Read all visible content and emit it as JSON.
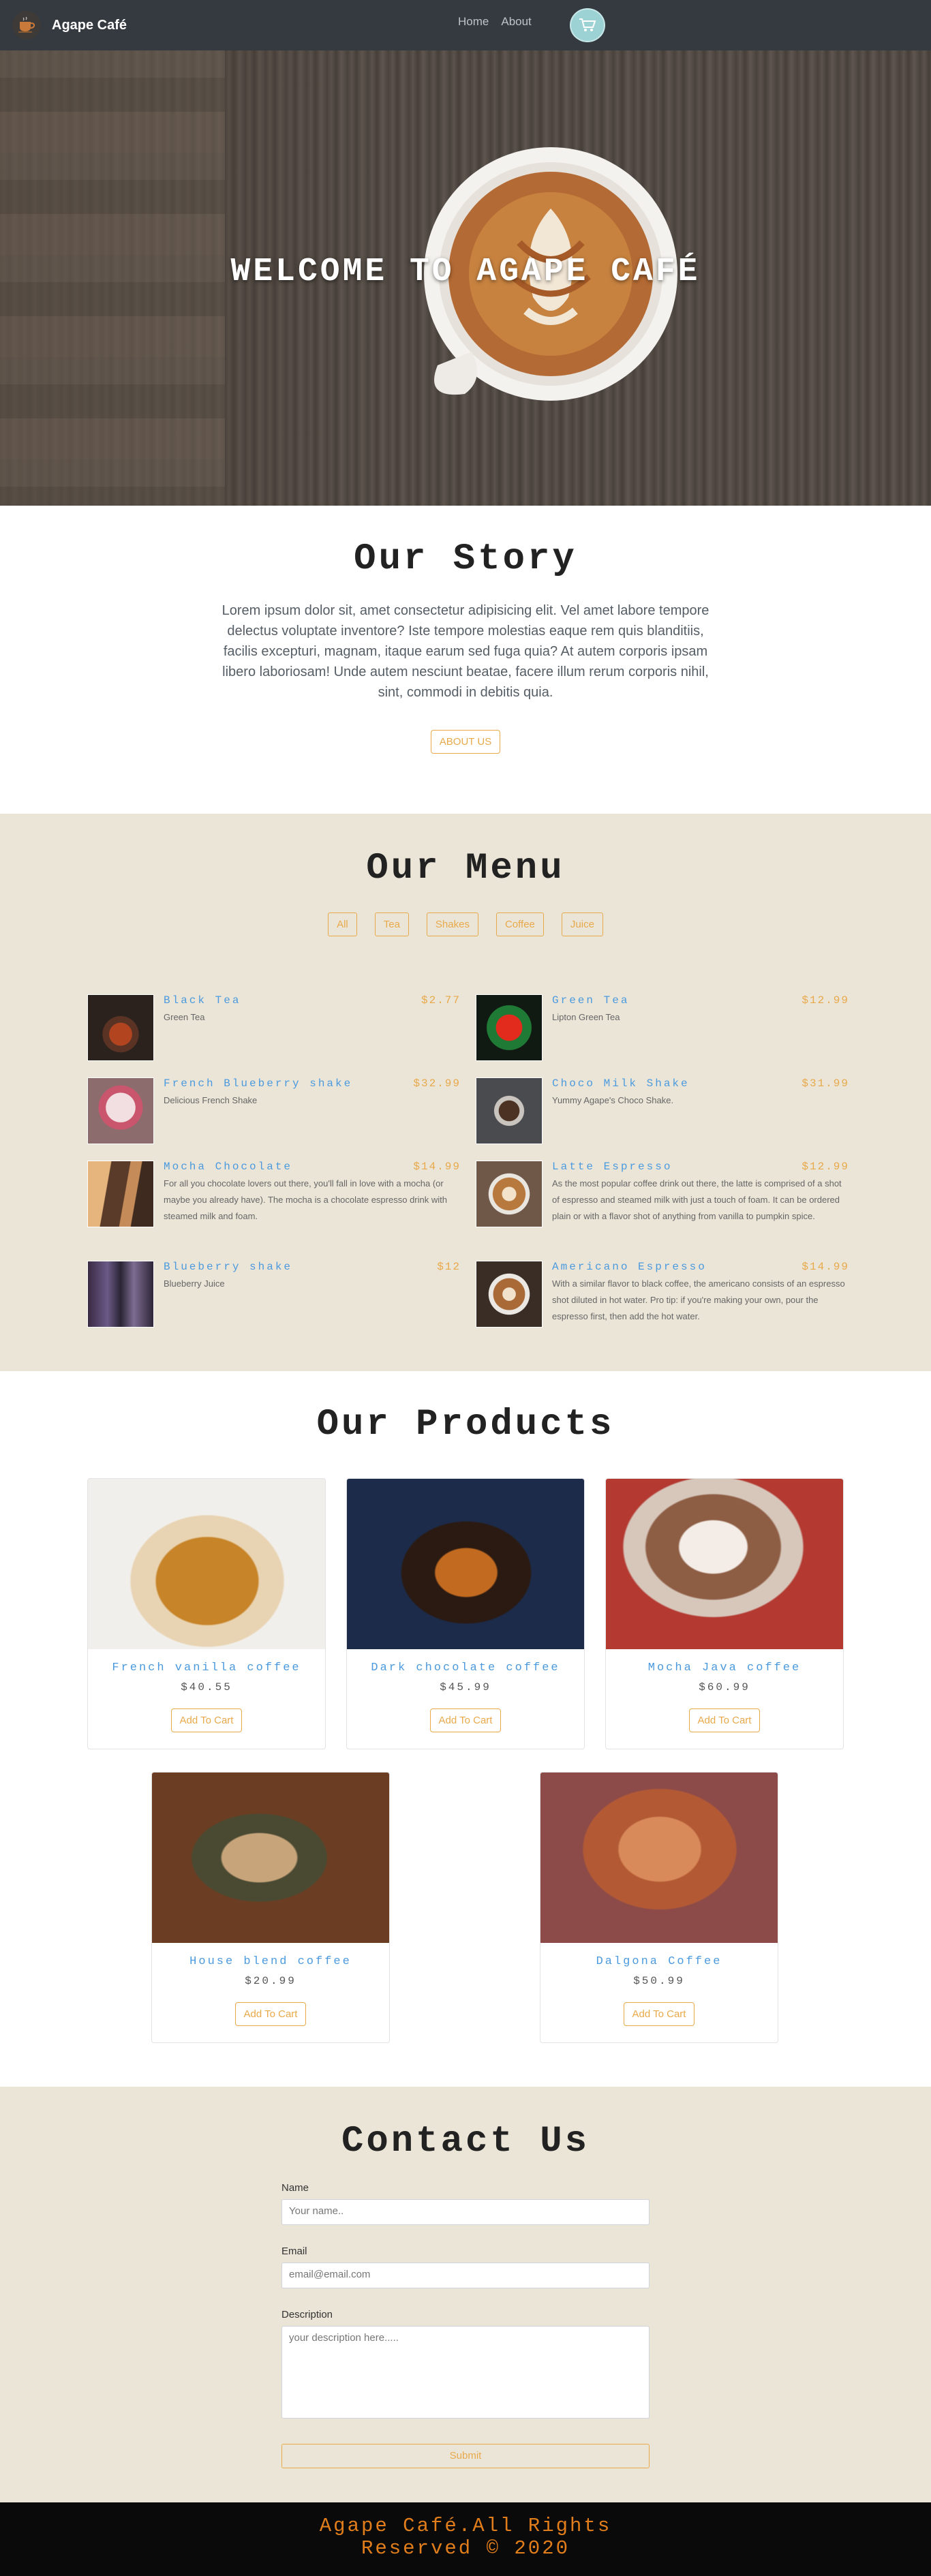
{
  "navbar": {
    "brand": "Agape Café",
    "links": [
      "Home",
      "About"
    ],
    "logo_icon": "coffee-cup-icon",
    "cart_icon": "shopping-cart-icon"
  },
  "hero": {
    "title": "WELCOME TO AGAPE CAFÉ"
  },
  "story": {
    "title": "Our Story",
    "text": "Lorem ipsum dolor sit, amet consectetur adipisicing elit. Vel amet labore tempore delectus voluptate inventore? Iste tempore molestias eaque rem quis blanditiis, facilis excepturi, magnam, itaque earum sed fuga quia? At autem corporis ipsam libero laboriosam! Unde autem nesciunt beatae, facere illum rerum corporis nihil, sint, commodi in debitis quia.",
    "button": "ABOUT US"
  },
  "menu": {
    "title": "Our Menu",
    "filters": [
      "All",
      "Tea",
      "Shakes",
      "Coffee",
      "Juice"
    ],
    "items": [
      {
        "name": "Black Tea",
        "price": "$2.77",
        "desc": "Green Tea"
      },
      {
        "name": "Green Tea",
        "price": "$12.99",
        "desc": "Lipton Green Tea"
      },
      {
        "name": "French Blueberry shake",
        "price": "$32.99",
        "desc": "Delicious French Shake"
      },
      {
        "name": "Choco Milk Shake",
        "price": "$31.99",
        "desc": "Yummy Agape's Choco Shake."
      },
      {
        "name": "Mocha Chocolate",
        "price": "$14.99",
        "desc": "For all you chocolate lovers out there, you'll fall in love with a mocha (or maybe you already have). The mocha is a chocolate espresso drink with steamed milk and foam."
      },
      {
        "name": "Latte Espresso",
        "price": "$12.99",
        "desc": "As the most popular coffee drink out there, the latte is comprised of a shot of espresso and steamed milk with just a touch of foam. It can be ordered plain or with a flavor shot of anything from vanilla to pumpkin spice."
      },
      {
        "name": "Blueberry shake",
        "price": "$12",
        "desc": "Blueberry Juice"
      },
      {
        "name": "Americano Espresso",
        "price": "$14.99",
        "desc": "With a similar flavor to black coffee, the americano consists of an espresso shot diluted in hot water. Pro tip: if you're making your own, pour the espresso first, then add the hot water."
      }
    ]
  },
  "products": {
    "title": "Our Products",
    "button": "Add To Cart",
    "items": [
      {
        "name": "French vanilla coffee",
        "price": "$40.55"
      },
      {
        "name": "Dark chocolate coffee",
        "price": "$45.99"
      },
      {
        "name": "Mocha Java coffee",
        "price": "$60.99"
      },
      {
        "name": "House blend coffee",
        "price": "$20.99"
      },
      {
        "name": "Dalgona Coffee",
        "price": "$50.99"
      }
    ]
  },
  "contact": {
    "title": "Contact Us",
    "name_label": "Name",
    "name_placeholder": "Your name..",
    "email_label": "Email",
    "email_placeholder": "email@email.com",
    "desc_label": "Description",
    "desc_placeholder": "your description here.....",
    "submit": "Submit"
  },
  "footer": {
    "text": "Agape Café.All Rights Reserved © 2020"
  },
  "colors": {
    "accent": "#e8a94a",
    "link_blue": "#4b9ade",
    "section_beige": "#ebe5d8",
    "navbar": "#343a40",
    "footer_text": "#e17d1b"
  }
}
